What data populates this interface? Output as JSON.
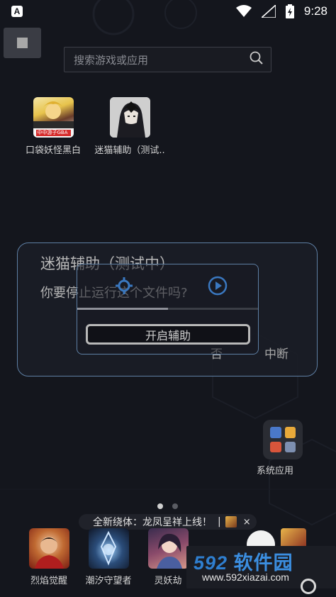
{
  "status_bar": {
    "app_badge": "A",
    "time": "9:28"
  },
  "search": {
    "placeholder": "搜索游戏或应用"
  },
  "desktop_apps": [
    {
      "label": "口袋妖怪黑白",
      "icon": "pokemon-black-white-icon",
      "badge": "中中游子GBA"
    },
    {
      "label": "迷猫辅助（测试..",
      "icon": "mimao-helper-icon"
    }
  ],
  "dialog": {
    "title": "迷猫辅助（测试中）",
    "message": "你要停止运行这个文件吗?",
    "no_label": "否",
    "abort_label": "中断"
  },
  "helper_panel": {
    "start_label": "开启辅助",
    "progress": 0.5
  },
  "system_folder": {
    "label": "系统应用",
    "colors": [
      "#4a78c9",
      "#e8a93a",
      "#d9553b",
      "#7d8fb0"
    ]
  },
  "page_dots": {
    "count": 2,
    "active": 0
  },
  "toast": {
    "text": "全新绕体：龙凤呈祥上线！",
    "separator": "|",
    "close": "×"
  },
  "dock_apps": [
    {
      "label": "烈焰觉醒",
      "icon": "flame-awaken-icon"
    },
    {
      "label": "潮汐守望者",
      "icon": "tide-guardian-icon"
    },
    {
      "label": "灵妖劫",
      "icon": "spirit-demon-icon"
    }
  ],
  "watermark": {
    "number": "592",
    "brand": "软件园",
    "url": "www.592xiazai.com"
  },
  "colors": {
    "accent_border": "#5e7fa4",
    "background": "#14161d"
  }
}
